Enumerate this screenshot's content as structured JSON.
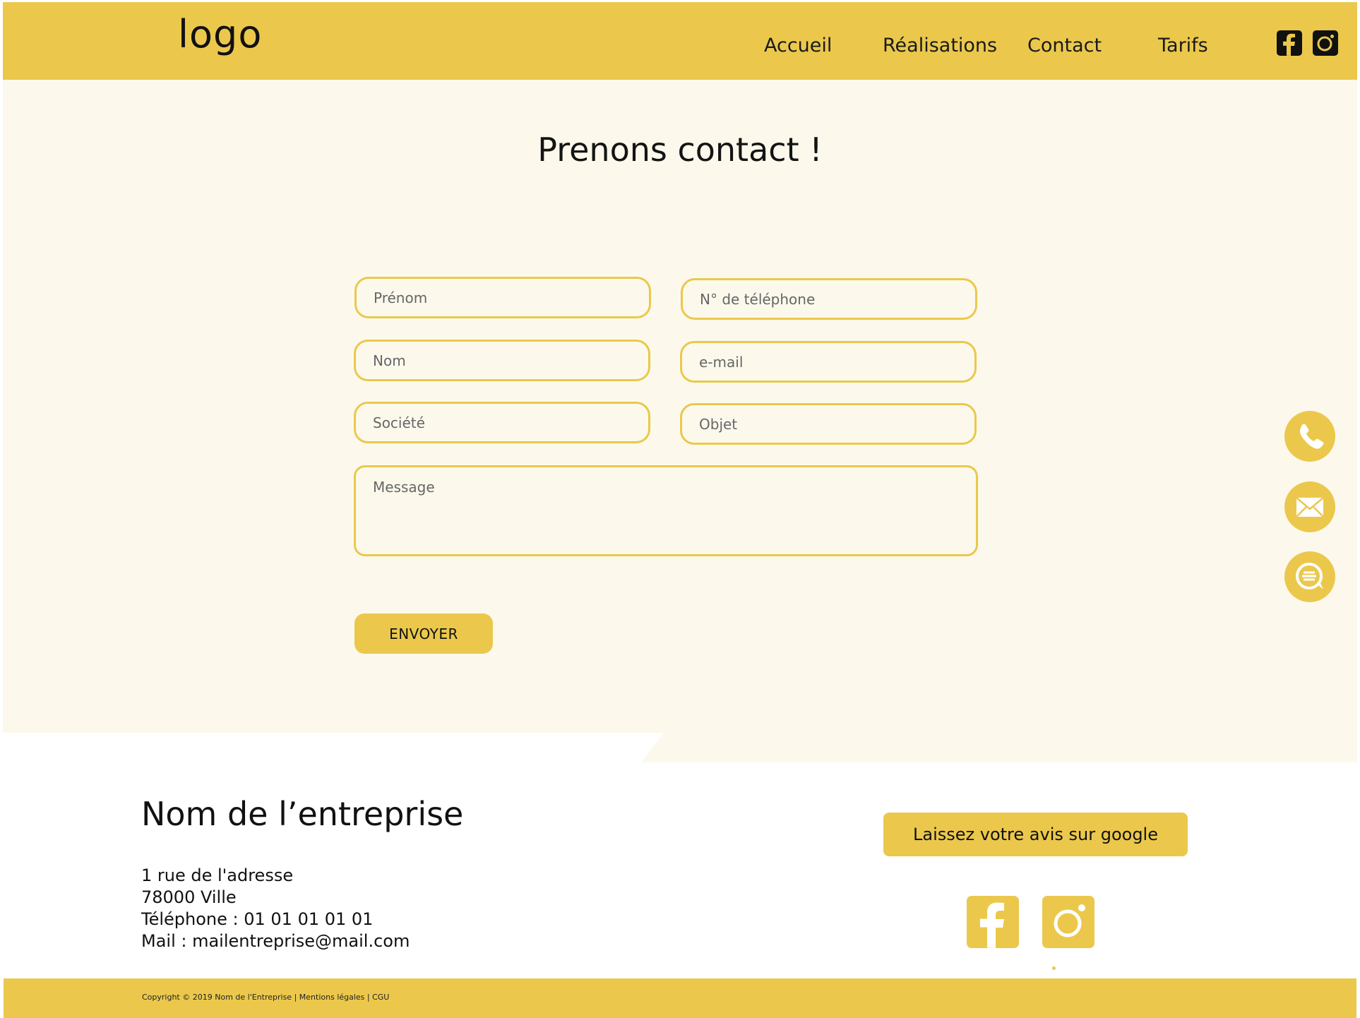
{
  "header": {
    "logo": "logo",
    "nav": [
      {
        "label": "Accueil"
      },
      {
        "label": "Réalisations"
      },
      {
        "label": "Contact"
      },
      {
        "label": "Tarifs"
      }
    ],
    "social_icons": [
      "facebook-icon",
      "instagram-icon"
    ]
  },
  "contact": {
    "title": "Prenons contact !",
    "fields": {
      "prenom": {
        "placeholder": "Prénom",
        "value": ""
      },
      "telephone": {
        "placeholder": "N° de téléphone",
        "value": ""
      },
      "nom": {
        "placeholder": "Nom",
        "value": ""
      },
      "email": {
        "placeholder": "e-mail",
        "value": ""
      },
      "societe": {
        "placeholder": "Société",
        "value": ""
      },
      "objet": {
        "placeholder": "Objet",
        "value": ""
      },
      "message": {
        "placeholder": "Message",
        "value": ""
      }
    },
    "submit_label": "ENVOYER"
  },
  "floating_actions": [
    "phone-icon",
    "mail-icon",
    "chat-icon"
  ],
  "footer": {
    "company_name": "Nom de l’entreprise",
    "address_line1": "1 rue de l'adresse",
    "address_line2": "78000 Ville",
    "phone": "Téléphone : 01 01 01 01 01",
    "mail": "Mail : mailentreprise@mail.com",
    "review_button": "Laissez votre avis sur google",
    "social_icons": [
      "facebook-icon",
      "instagram-icon"
    ],
    "copyright": "Copyright © 2019 Nom de l'Entreprise | Mentions légales | CGU"
  },
  "colors": {
    "accent": "#ebc84c",
    "background": "#fcf9ec",
    "text": "#111111"
  }
}
